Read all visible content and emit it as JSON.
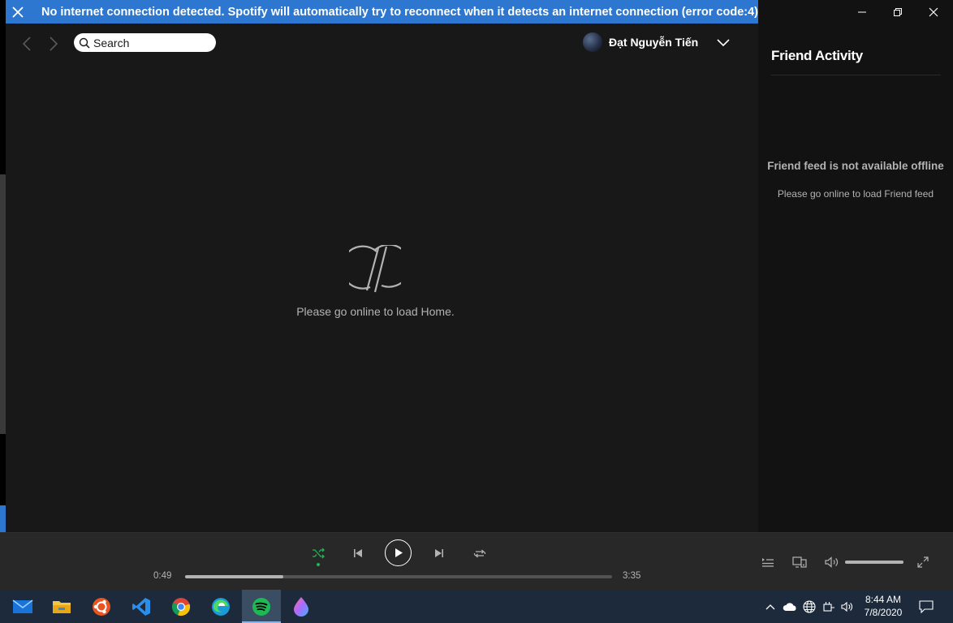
{
  "banner": {
    "message": "No internet connection detected. Spotify will automatically try to reconnect when it detects an internet connection (error code:4)"
  },
  "header": {
    "search_placeholder": "Search",
    "user_name": "Đạt Nguyễn Tiến"
  },
  "main": {
    "offline_message": "Please go online to load Home."
  },
  "friend_activity": {
    "title": "Friend Activity",
    "heading": "Friend feed is not available offline",
    "subtext": "Please go online to load Friend feed"
  },
  "player": {
    "elapsed": "0:49",
    "duration": "3:35",
    "progress_fraction": 0.23,
    "volume_fraction": 1.0,
    "shuffle_active": true
  },
  "taskbar": {
    "apps": [
      "mail-icon",
      "file-explorer-icon",
      "ubuntu-icon",
      "vscode-icon",
      "chrome-icon",
      "edge-icon",
      "spotify-icon",
      "paint-icon"
    ],
    "active_app": "spotify-icon",
    "time": "8:44 AM",
    "date": "7/8/2020"
  },
  "colors": {
    "banner": "#2e77d0",
    "spotify_green": "#1db954",
    "main_bg": "#181818",
    "sidebar_bg": "#121212",
    "player_bg": "#282828",
    "taskbar_bg": "#1c2a3b"
  }
}
